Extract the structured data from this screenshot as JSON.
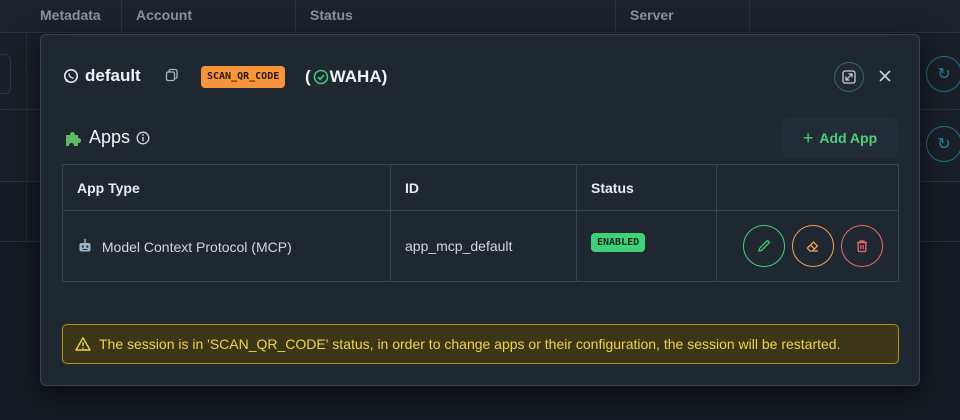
{
  "background": {
    "columns": [
      "Metadata",
      "Account",
      "Status",
      "Server"
    ]
  },
  "modal": {
    "session_name": "default",
    "status": "SCAN_QR_CODE",
    "engine_open": "(",
    "engine_name": "WAHA)",
    "icons": {
      "whatsapp": "whatsapp-icon",
      "copy": "copy-icon",
      "check": "check-circle-icon",
      "expand": "expand-icon",
      "close": "close-icon"
    },
    "apps": {
      "heading": "Apps",
      "add_label": "Add App",
      "columns": [
        "App Type",
        "ID",
        "Status",
        ""
      ],
      "rows": [
        {
          "type": "Model Context Protocol (MCP)",
          "id": "app_mcp_default",
          "status": "ENABLED"
        }
      ]
    },
    "warning": "The session is in 'SCAN_QR_CODE' status, in order to change apps or their configuration, the session will be restarted."
  },
  "colors": {
    "accent_green": "#3ecf7a",
    "status_orange": "#f7943c",
    "warning_yellow": "#f0d34a",
    "danger_red": "#e86a6a"
  }
}
